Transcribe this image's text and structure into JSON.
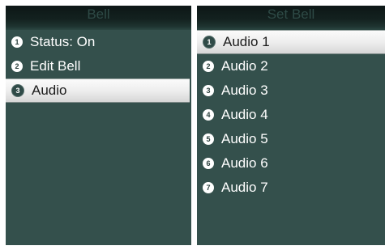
{
  "left_screen": {
    "title": "Bell",
    "items": [
      {
        "number": "1",
        "label": "Status: On"
      },
      {
        "number": "2",
        "label": "Edit Bell"
      },
      {
        "number": "3",
        "label": "Audio"
      }
    ],
    "selected_index": 2
  },
  "right_screen": {
    "title": "Set Bell",
    "items": [
      {
        "number": "1",
        "label": "Audio 1"
      },
      {
        "number": "2",
        "label": "Audio 2"
      },
      {
        "number": "3",
        "label": "Audio 3"
      },
      {
        "number": "4",
        "label": "Audio 4"
      },
      {
        "number": "5",
        "label": "Audio 5"
      },
      {
        "number": "6",
        "label": "Audio 6"
      },
      {
        "number": "7",
        "label": "Audio 7"
      }
    ],
    "selected_index": 0
  },
  "colors": {
    "screen_bg": "#34504c",
    "title_bar_dark": "#0d1716",
    "title_text": "#2e4a46",
    "selection_bg": "#ececec",
    "item_text": "#ffffff"
  }
}
